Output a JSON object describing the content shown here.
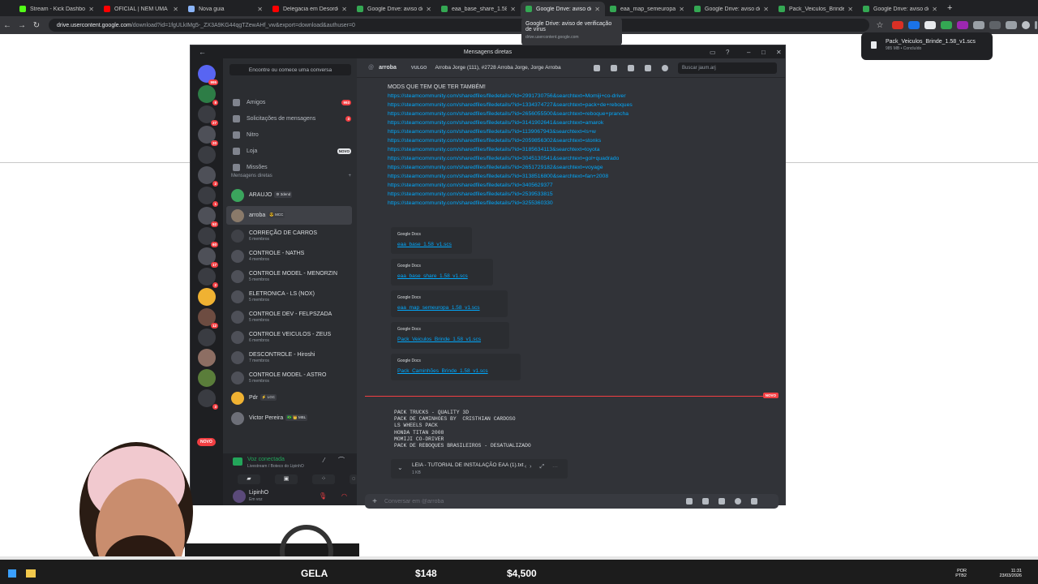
{
  "browser": {
    "tabs": [
      {
        "label": "Stream - Kick Dashboard",
        "color": "#53fc18"
      },
      {
        "label": "OFICIAL | NEM UMA",
        "color": "#ff0000"
      },
      {
        "label": "Nova guia",
        "color": "#8ab4f8"
      },
      {
        "label": "Delegacia em Desordem",
        "color": "#ff0000"
      },
      {
        "label": "Google Drive: aviso de ví",
        "color": "#34a853"
      },
      {
        "label": "eaa_base_share_1.58_v1",
        "color": "#34a853"
      },
      {
        "label": "Google Drive: aviso de ví",
        "color": "#34a853",
        "active": true
      },
      {
        "label": "eaa_map_semeuropa_1.5",
        "color": "#34a853"
      },
      {
        "label": "Google Drive: aviso de ví",
        "color": "#34a853"
      },
      {
        "label": "Pack_Veiculos_Brinde_1.5",
        "color": "#34a853"
      },
      {
        "label": "Google Drive: aviso de ví",
        "color": "#34a853"
      }
    ],
    "url_host": "drive.usercontent.google.com",
    "url_path": "/download?id=1fgULkIMg5-_ZX3A9KG44qgTZewAHf_vw&export=download&authuser=0",
    "tooltip_title": "Google Drive: aviso de verificação de vírus",
    "tooltip_sub": "drive.usercontent.google.com",
    "download_file": "Pack_Veiculos_Brinde_1.58_v1.scs",
    "download_status": "985 MB • Concluído"
  },
  "discord": {
    "window_title": "Mensagens diretas",
    "find_placeholder": "Encontre ou comece uma conversa",
    "nav": [
      {
        "label": "Amigos",
        "badge": "993"
      },
      {
        "label": "Solicitações de mensagens",
        "badge": "3"
      },
      {
        "label": "Nitro",
        "badge": ""
      },
      {
        "label": "Loja",
        "badge": "NOVO"
      },
      {
        "label": "Missões",
        "badge": ""
      }
    ],
    "dm_header": "Mensagens diretas",
    "dms": [
      {
        "name": "ARAUJO",
        "tag": "⚙ 3dend",
        "sub": "",
        "color": "#3ba55d"
      },
      {
        "name": "arroba",
        "tag": "😎 MCC",
        "sub": "",
        "color": "#8a7a6a",
        "selected": true
      },
      {
        "name": "CORREÇÃO DE CARROS",
        "tag": "",
        "sub": "6 membros",
        "color": "#3f4147"
      },
      {
        "name": "CONTROLE - NATHS",
        "tag": "",
        "sub": "4 membros",
        "color": "#4e5058"
      },
      {
        "name": "CONTROLE MODEL - MENORZIN",
        "tag": "",
        "sub": "5 membros",
        "color": "#4e5058"
      },
      {
        "name": "ELETRONICA - LS (NOX)",
        "tag": "",
        "sub": "5 membros",
        "color": "#4e5058"
      },
      {
        "name": "CONTROLE DEV - FELPSZADA",
        "tag": "",
        "sub": "5 membros",
        "color": "#4e5058"
      },
      {
        "name": "CONTROLE VEICULOS - ZEUS",
        "tag": "",
        "sub": "6 membros",
        "color": "#4e5058"
      },
      {
        "name": "DESCONTROLE - Hiroshi",
        "tag": "",
        "sub": "7 membros",
        "color": "#4e5058"
      },
      {
        "name": "CONTROLE MODEL - ASTRO",
        "tag": "",
        "sub": "5 membros",
        "color": "#4e5058"
      },
      {
        "name": "Pdr",
        "tag": "⚡ LGC",
        "sub": "",
        "color": "#f0b232"
      },
      {
        "name": "Victor Pereira",
        "tag": "🇧🇷 👑 MBL",
        "sub": "",
        "color": "#6d6f78"
      }
    ],
    "server_badges": [
      "995",
      "8",
      "27",
      "20",
      "",
      "2",
      "1",
      "52",
      "60",
      "17",
      "2",
      "",
      "12",
      "",
      "",
      "",
      "3"
    ],
    "novo_pill": "NOVO",
    "voice": {
      "status": "Voz conectada",
      "channel": "Livestream / Boteco do LipinhO"
    },
    "user": {
      "name": "LipinhO",
      "status": "Em voz"
    },
    "chat": {
      "name": "arroba",
      "vulgo": "VULGO",
      "fullname": "Arroba Jorge (111), #2728 Arroba Jorge, Jorge Arroba",
      "search_placeholder": "Buscar jaum.arj",
      "heading": "MODS QUE TEM QUE TER TAMBÉM!",
      "links": [
        "https://steamcommunity.com/sharedfiles/filedetails/?id=2991730756&searchtext=Momiji+co-driver",
        "https://steamcommunity.com/sharedfiles/filedetails/?id=1334374727&searchtext=pack+de+reboques",
        "https://steamcommunity.com/sharedfiles/filedetails/?id=2656055500&searchtext=reboque+prancha",
        "https://steamcommunity.com/sharedfiles/filedetails/?id=3141902641&searchtext=amarok",
        "https://steamcommunity.com/sharedfiles/filedetails/?id=1139067943&searchtext=ls+w",
        "https://steamcommunity.com/sharedfiles/filedetails/?id=2059856302&searchtext=stonks",
        "https://steamcommunity.com/sharedfiles/filedetails/?id=3185634113&searchtext=toyota",
        "https://steamcommunity.com/sharedfiles/filedetails/?id=3045130541&searchtext=gol+quadrado",
        "https://steamcommunity.com/sharedfiles/filedetails/?id=2651729182&searchtext=voyage",
        "https://steamcommunity.com/sharedfiles/filedetails/?id=3138516800&searchtext=fan+2008",
        "https://steamcommunity.com/sharedfiles/filedetails/?id=3405629377",
        "https://steamcommunity.com/sharedfiles/filedetails/?id=2539533815",
        "https://steamcommunity.com/sharedfiles/filedetails/?id=3255360330"
      ],
      "embeds": [
        {
          "provider": "Google Docs",
          "file": "eaa_base_1.58_v1.scs"
        },
        {
          "provider": "Google Docs",
          "file": "eaa_base_share_1.58_v1.scs"
        },
        {
          "provider": "Google Docs",
          "file": "eaa_map_semeuropa_1.58_v1.scs"
        },
        {
          "provider": "Google Docs",
          "file": "Pack_Veiculos_Brinde_1.58_v1.scs"
        },
        {
          "provider": "Google Docs",
          "file": "Pack_Caminhões_Brinde_1.58_v1.scs"
        }
      ],
      "new_label": "NOVO",
      "code_lines": "PACK TRUCKS - QUALITY 3D\nPACK DE CAMINHOES BY  CRISTHIAN CARDOSO\nLS WHEELS PACK\nHONDA TITAN 2008\nMOMIJI CO-DRIVER\nPACK DE REBOQUES BRASILEIROS - DESATUALIZADO",
      "attachment_name": "LEIA - TUTORIAL DE INSTALAÇÃO EAA (1).txt",
      "attachment_size": "1 KB",
      "composer_placeholder": "Conversar em @arroba"
    }
  },
  "overlay": {
    "gela": "GELA",
    "v1": "$148",
    "v2": "$4,500"
  },
  "taskbar": {
    "lang": "POR",
    "lang2": "PTB2",
    "time": "11:31",
    "date": "23/03/2026"
  }
}
